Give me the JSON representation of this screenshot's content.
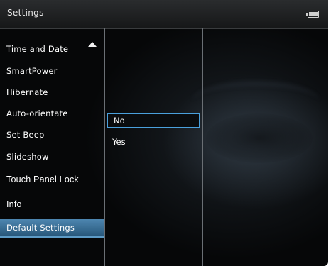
{
  "header": {
    "title": "Settings",
    "battery_icon": "battery-icon"
  },
  "menu": {
    "scroll_indicator": "triangle-up-icon",
    "items": [
      {
        "label": "Time and Date"
      },
      {
        "label": "SmartPower"
      },
      {
        "label": "Hibernate"
      },
      {
        "label": "Auto-orientate"
      },
      {
        "label": "Set Beep"
      },
      {
        "label": "Slideshow"
      },
      {
        "label": "Touch Panel Lock"
      },
      {
        "label": "Info"
      },
      {
        "label": "Default Settings",
        "selected": true
      }
    ]
  },
  "options": [
    {
      "label": "No",
      "focused": true
    },
    {
      "label": "Yes"
    }
  ],
  "colors": {
    "accent": "#4aa0dc",
    "selected_bg": "#3f76a0",
    "background": "#060708"
  }
}
